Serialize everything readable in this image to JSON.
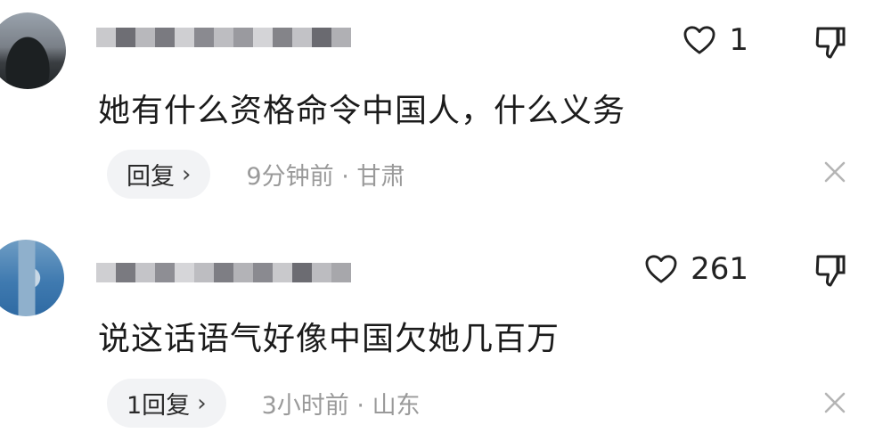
{
  "comments": [
    {
      "text": "她有什么资格命令中国人，什么义务",
      "likes": "1",
      "reply_label": "回复",
      "time": "9分钟前",
      "location": "甘肃"
    },
    {
      "text": "说这话语气好像中国欠她几百万",
      "likes": "261",
      "reply_label": "1回复",
      "time": "3小时前",
      "location": "山东"
    }
  ],
  "meta_separator": "·",
  "icons": [
    "heart-icon",
    "dislike-icon",
    "chevron-right-icon",
    "close-icon",
    "avatar"
  ],
  "colors": {
    "meta_gray": "#9a9a9a",
    "reply_bg": "#f2f3f5",
    "text": "#1b1b1b"
  }
}
